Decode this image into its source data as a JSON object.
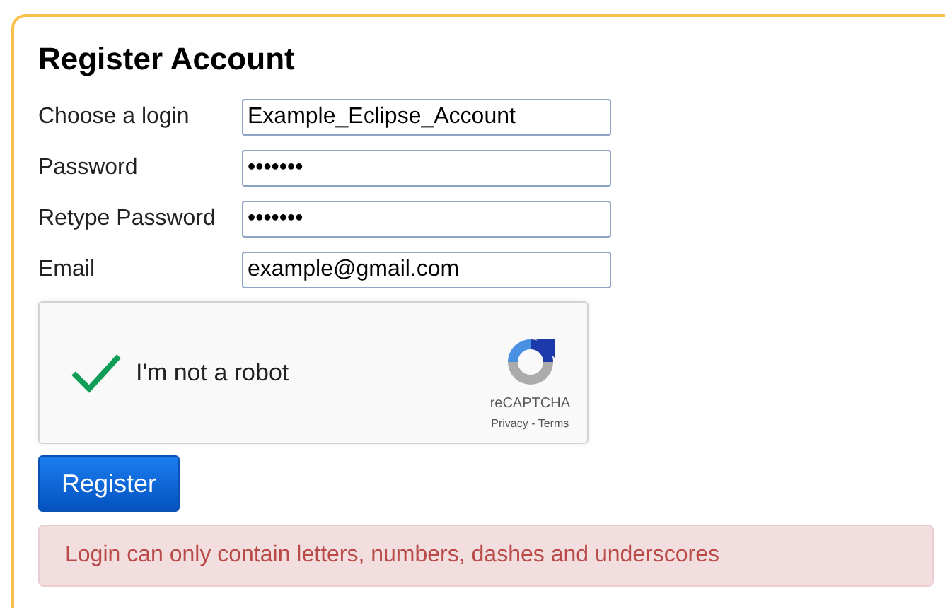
{
  "title": "Register Account",
  "fields": [
    {
      "label": "Choose a login",
      "value": "Example_Eclipse_Account"
    },
    {
      "label": "Password",
      "value": "•••••••"
    },
    {
      "label": "Retype Password",
      "value": "•••••••"
    },
    {
      "label": "Email",
      "value": "example@gmail.com"
    }
  ],
  "captcha": {
    "label": "I'm not a robot",
    "checked": true,
    "brand": "reCAPTCHA",
    "privacy": "Privacy",
    "separator": "-",
    "terms": "Terms"
  },
  "register_button": "Register",
  "error": "Login can only contain letters, numbers, dashes and underscores"
}
